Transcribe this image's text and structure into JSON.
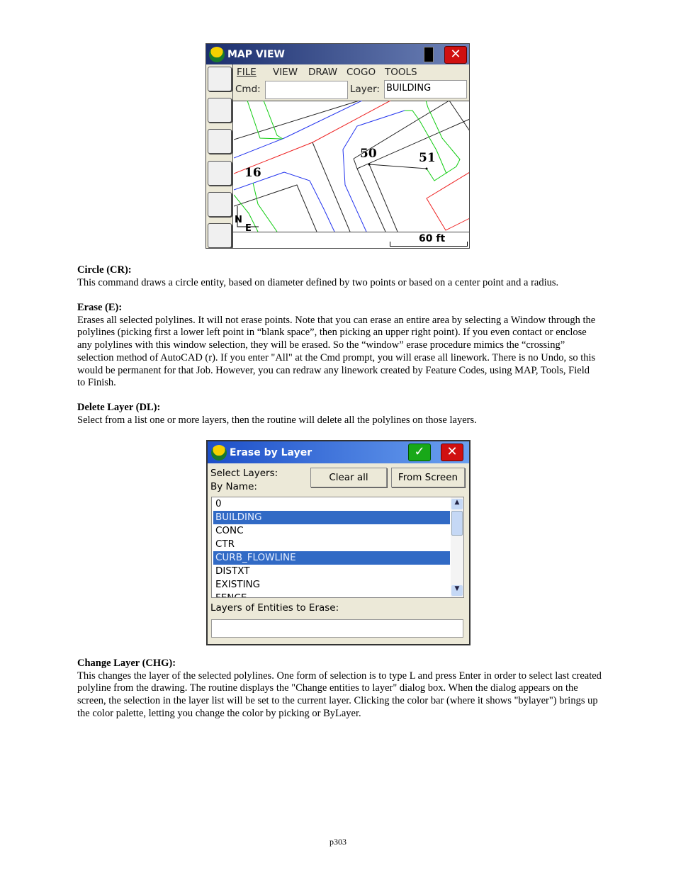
{
  "map_view": {
    "title": "MAP VIEW",
    "menu": [
      "FILE",
      "VIEW",
      "DRAW",
      "COGO",
      "TOOLS"
    ],
    "cmd_label": "Cmd:",
    "cmd_value": "",
    "layer_label": "Layer:",
    "layer_value": "BUILDING",
    "tools": [
      "zoom-extents-icon",
      "zoom-in-icon",
      "zoom-out-icon",
      "zoom-window-icon",
      "zoom-previous-icon",
      "zoom-settings-icon"
    ],
    "point_labels": [
      "16",
      "50",
      "51"
    ],
    "north": "N",
    "east": "E",
    "scale": "60 ft"
  },
  "sections": [
    {
      "heading": "Circle (CR):",
      "body": "This command draws a circle entity, based on diameter defined by two points or based on a center point and a radius."
    },
    {
      "heading": "Erase (E):",
      "body": "Erases all selected polylines.  It will not erase points.  Note that you can erase an entire area by selecting a Window through the polylines (picking first a lower left point in “blank space”, then picking an upper right point).  If you even contact or enclose any polylines with this window selection, they will be erased.  So the “window” erase procedure mimics the “crossing” selection method of AutoCAD (r).  If you enter \"All\" at the Cmd prompt, you will erase all linework.  There is no Undo, so this would be permanent for that Job.  However, you can redraw any linework created by Feature Codes, using MAP, Tools, Field to Finish."
    },
    {
      "heading": "Delete Layer (DL):",
      "body": "Select from a list one or more layers, then the routine will delete all the polylines on those layers."
    },
    {
      "heading": "Change Layer (CHG):",
      "body": "This changes the layer of the selected polylines. One form of selection is to type L and press Enter in order to select last created polyline from the drawing. The routine displays the \"Change entities to layer\" dialog box. When the dialog appears on the screen, the selection in the layer list will be set to the current layer. Clicking the color bar (where it shows \"bylayer\") brings up the color palette, letting you change the color by picking or ByLayer."
    }
  ],
  "erase_dialog": {
    "title": "Erase by Layer",
    "select_label": "Select Layers:",
    "by_name_label": "By Name:",
    "clear_all": "Clear all",
    "from_screen": "From Screen",
    "layers": [
      {
        "name": "0",
        "selected": false
      },
      {
        "name": "BUILDING",
        "selected": true
      },
      {
        "name": "CONC",
        "selected": false
      },
      {
        "name": "CTR",
        "selected": false
      },
      {
        "name": "CURB_FLOWLINE",
        "selected": true
      },
      {
        "name": "DISTXT",
        "selected": false
      },
      {
        "name": "EXISTING",
        "selected": false
      },
      {
        "name": "FENCE",
        "selected": false
      }
    ],
    "entities_label": "Layers of Entities to Erase:",
    "entities_value": ""
  },
  "footer": {
    "page": "p303"
  }
}
